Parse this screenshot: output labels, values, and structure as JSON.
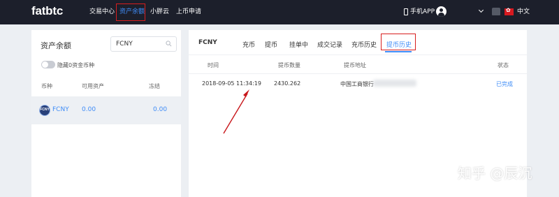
{
  "brand": {
    "logo": "fatbtc"
  },
  "nav": {
    "items": [
      "交易中心",
      "资产余额",
      "小胖云",
      "上币申请"
    ],
    "phone_app": "手机APP",
    "language": "中文"
  },
  "left": {
    "title": "资产余额",
    "search_value": "FCNY",
    "hide_zero_label": "隐藏0资金币种",
    "headers": [
      "币种",
      "可用资产",
      "冻结"
    ],
    "asset": {
      "name": "FCNY",
      "icon_text": "FCNY",
      "available": "0.00",
      "frozen": "0.00"
    }
  },
  "right": {
    "title": "FCNY",
    "tabs": [
      "充币",
      "提币",
      "挂单中",
      "成交记录",
      "充币历史",
      "提币历史"
    ],
    "active_tab": "提币历史",
    "headers": [
      "时间",
      "提币数量",
      "提币地址",
      "状态"
    ],
    "row": {
      "time": "2018-09-05 11:34:19",
      "amount": "2430.262",
      "address": "中国工商银行",
      "status": "已完成"
    }
  },
  "watermark": "知乎 @辰沉",
  "colors": {
    "accent": "#3f8cf7",
    "topbar": "#1c1f2b",
    "highlight_box": "#d81e1e",
    "page_bg": "#eceff3"
  }
}
